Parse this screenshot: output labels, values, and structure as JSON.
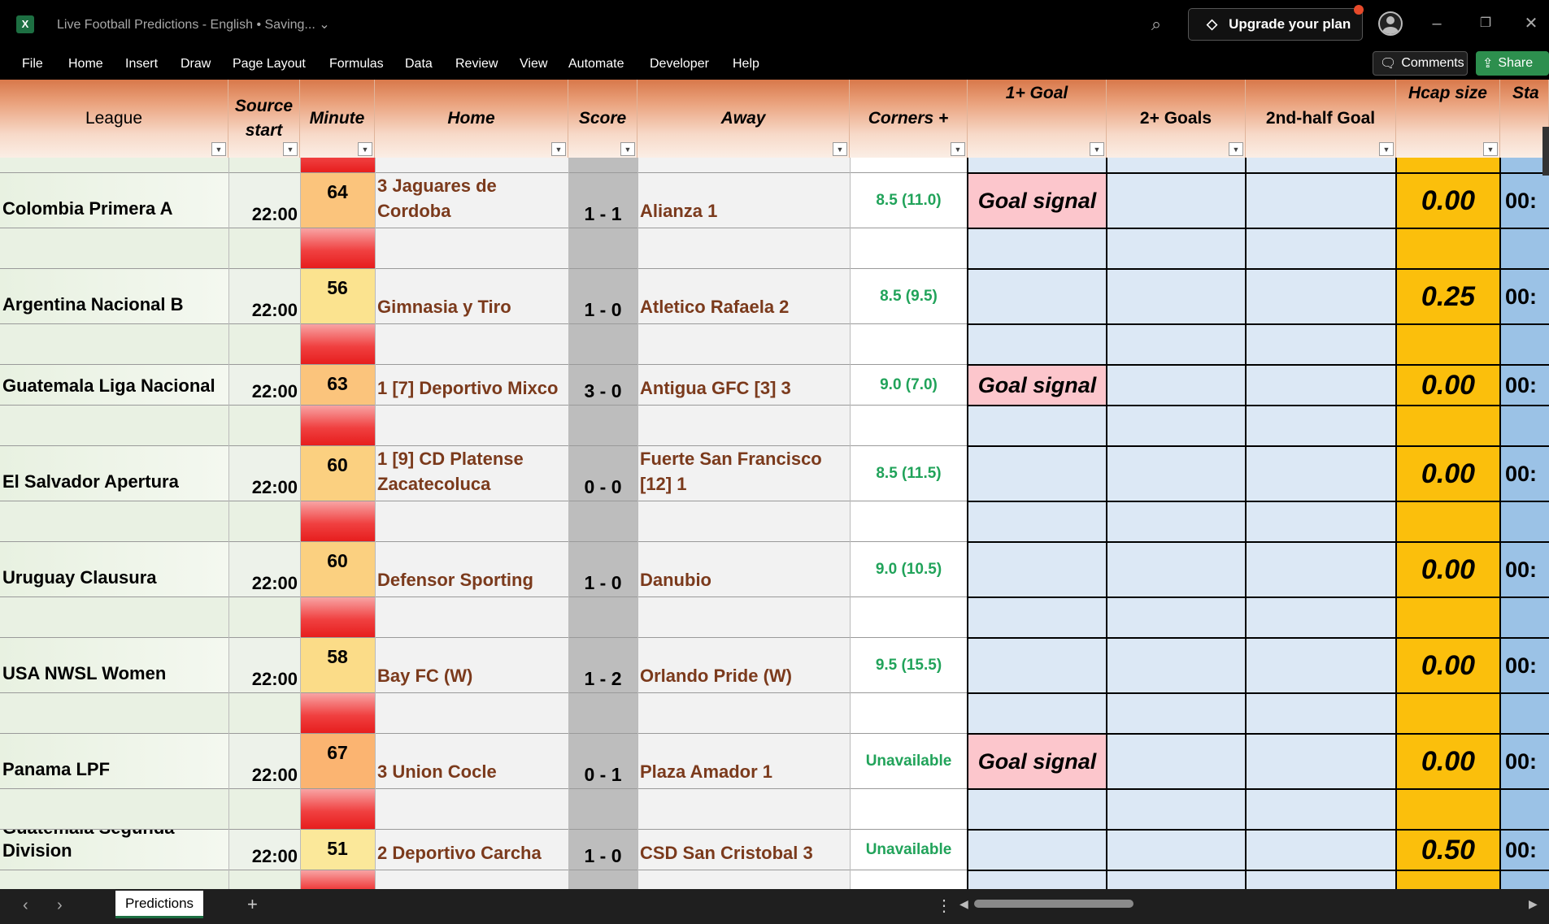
{
  "window": {
    "app_icon": "X",
    "title": "Live Football Predictions - English • Saving...",
    "upgrade_label": "Upgrade your plan",
    "icons": [
      "excel-icon",
      "search-icon",
      "diamond-icon",
      "avatar-icon",
      "minimize-icon",
      "restore-icon",
      "close-icon"
    ]
  },
  "ribbon": {
    "menu": [
      "File",
      "Home",
      "Insert",
      "Draw",
      "Page Layout",
      "Formulas",
      "Data",
      "Review",
      "View",
      "Automate",
      "Developer",
      "Help"
    ],
    "comments_label": "Comments",
    "share_label": "Share"
  },
  "sheet": {
    "headers": {
      "league": "League",
      "source_start": "Source start",
      "minute": "Minute",
      "home": "Home",
      "score": "Score",
      "away": "Away",
      "corners": "Corners +",
      "goal1": "1+ Goal",
      "goal2": "2+ Goals",
      "halfgoal": "2nd-half Goal",
      "hcap": "Hcap size",
      "status": "Sta"
    },
    "rows": [
      {
        "league": "Colombia Primera A",
        "start": "22:00",
        "minute": "64",
        "home": "3 Jaguares de Cordoba",
        "score": "1 - 1",
        "away": "Alianza 1",
        "corners": "8.5 (11.0)",
        "goal1": "Goal signal",
        "hcap": "0.00",
        "status": "00:",
        "minute_color": "#fbc47c"
      },
      {
        "league": "Argentina Nacional B",
        "start": "22:00",
        "minute": "56",
        "home": "Gimnasia y Tiro",
        "score": "1 - 0",
        "away": "Atletico Rafaela 2",
        "corners": "8.5 (9.5)",
        "goal1": "",
        "hcap": "0.25",
        "status": "00:",
        "minute_color": "#fbe38f"
      },
      {
        "league": "Guatemala Liga Nacional",
        "start": "22:00",
        "minute": "63",
        "home": "1 [7] Deportivo Mixco",
        "score": "3 - 0",
        "away": "Antigua GFC [3] 3",
        "corners": "9.0 (7.0)",
        "goal1": "Goal signal",
        "hcap": "0.00",
        "status": "00:",
        "minute_color": "#fbc47c"
      },
      {
        "league": "El Salvador Apertura",
        "start": "22:00",
        "minute": "60",
        "home": "1 [9] CD Platense Zacatecoluca",
        "score": "0 - 0",
        "away": "Fuerte San Francisco [12] 1",
        "corners": "8.5 (11.5)",
        "goal1": "",
        "hcap": "0.00",
        "status": "00:",
        "minute_color": "#fbd080"
      },
      {
        "league": "Uruguay Clausura",
        "start": "22:00",
        "minute": "60",
        "home": "Defensor Sporting",
        "score": "1 - 0",
        "away": "Danubio",
        "corners": "9.0 (10.5)",
        "goal1": "",
        "hcap": "0.00",
        "status": "00:",
        "minute_color": "#fbd080"
      },
      {
        "league": "USA NWSL Women",
        "start": "22:00",
        "minute": "58",
        "home": "Bay FC (W)",
        "score": "1 - 2",
        "away": "Orlando Pride (W)",
        "corners": "9.5 (15.5)",
        "goal1": "",
        "hcap": "0.00",
        "status": "00:",
        "minute_color": "#fbdc88"
      },
      {
        "league": "Panama LPF",
        "start": "22:00",
        "minute": "67",
        "home": "3 Union Cocle",
        "score": "0 - 1",
        "away": "Plaza Amador 1",
        "corners": "Unavailable",
        "goal1": "Goal signal",
        "hcap": "0.00",
        "status": "00:",
        "minute_color": "#fbb471"
      },
      {
        "league": "Guatemala Segunda Division",
        "start": "22:00",
        "minute": "51",
        "home": "2 Deportivo Carcha",
        "score": "1 - 0",
        "away": "CSD San Cristobal 3",
        "corners": "Unavailable",
        "goal1": "",
        "hcap": "0.50",
        "status": "00:",
        "minute_color": "#fbe89a"
      }
    ]
  },
  "bottombar": {
    "sheet_tab": "Predictions",
    "add_sheet": "+",
    "more": "⋮",
    "prev": "‹",
    "next": "›"
  }
}
